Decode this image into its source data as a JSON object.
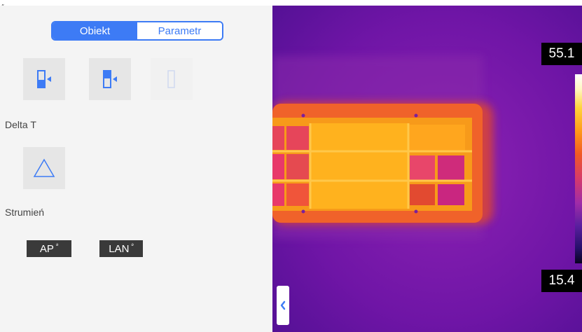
{
  "header": {
    "edge_mark": "„"
  },
  "tabs": {
    "active": "Obiekt",
    "inactive": "Parametr"
  },
  "sections": {
    "delta": "Delta T",
    "stream": "Strumień"
  },
  "stream": {
    "ap": "AP",
    "ap_sup": "ᵊ",
    "lan": "LAN",
    "lan_sup": "ᵊ"
  },
  "scale": {
    "max": "55.1",
    "min": "15.4"
  },
  "icons": {
    "object_tool_1": "object-bar-left-icon",
    "object_tool_2": "object-bar-right-icon",
    "object_tool_3": "object-empty-icon",
    "delta": "triangle-icon",
    "collapse": "chevron-left-icon"
  },
  "colors": {
    "accent": "#3d7bf5",
    "panel": "#f4f4f4",
    "tag": "#3a3a3a"
  }
}
